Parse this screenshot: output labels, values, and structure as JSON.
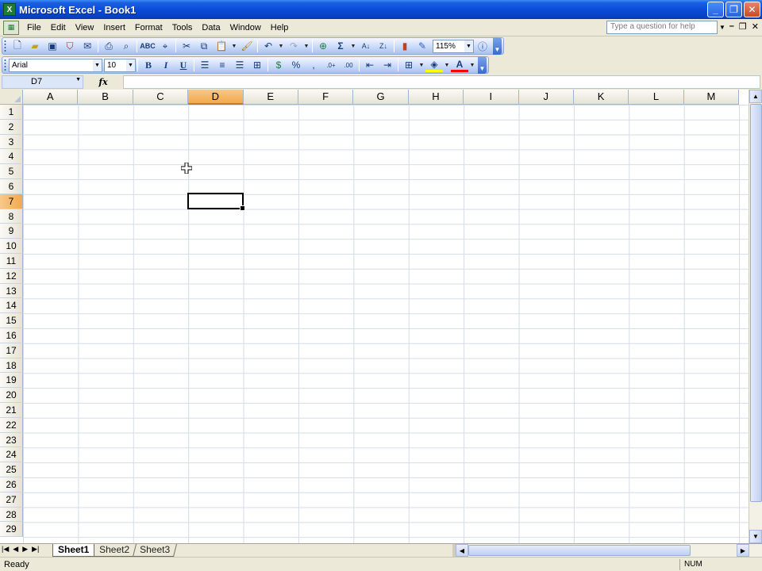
{
  "window": {
    "title": "Microsoft Excel - Book1",
    "minimize_label": "_",
    "restore_label": "❐",
    "close_label": "✕"
  },
  "menu": {
    "items": [
      {
        "label": "File"
      },
      {
        "label": "Edit"
      },
      {
        "label": "View"
      },
      {
        "label": "Insert"
      },
      {
        "label": "Format"
      },
      {
        "label": "Tools"
      },
      {
        "label": "Data"
      },
      {
        "label": "Window"
      },
      {
        "label": "Help"
      }
    ],
    "help_placeholder": "Type a question for help"
  },
  "standard_toolbar": {
    "zoom": "115%"
  },
  "formatting_toolbar": {
    "font_name": "Arial",
    "font_size": "10",
    "bold_label": "B",
    "italic_label": "I",
    "underline_label": "U",
    "percent_label": "%",
    "comma_label": ","
  },
  "formula_bar": {
    "name_box": "D7",
    "fx_label": "fx",
    "formula": ""
  },
  "grid": {
    "columns": [
      "A",
      "B",
      "C",
      "D",
      "E",
      "F",
      "G",
      "H",
      "I",
      "J",
      "K",
      "L",
      "M"
    ],
    "rows": [
      "1",
      "2",
      "3",
      "4",
      "5",
      "6",
      "7",
      "8",
      "9",
      "10",
      "11",
      "12",
      "13",
      "14",
      "15",
      "16",
      "17",
      "18",
      "19",
      "20",
      "21",
      "22",
      "23",
      "24",
      "25",
      "26",
      "27",
      "28",
      "29"
    ],
    "active_column": "D",
    "active_row": "7"
  },
  "sheets": [
    {
      "label": "Sheet1",
      "active": true
    },
    {
      "label": "Sheet2",
      "active": false
    },
    {
      "label": "Sheet3",
      "active": false
    }
  ],
  "status": {
    "ready": "Ready",
    "num": "NUM"
  },
  "colors": {
    "title_bar": "#0a4ad6",
    "active_header": "#f3a94a",
    "gridline": "#d4dce8"
  }
}
